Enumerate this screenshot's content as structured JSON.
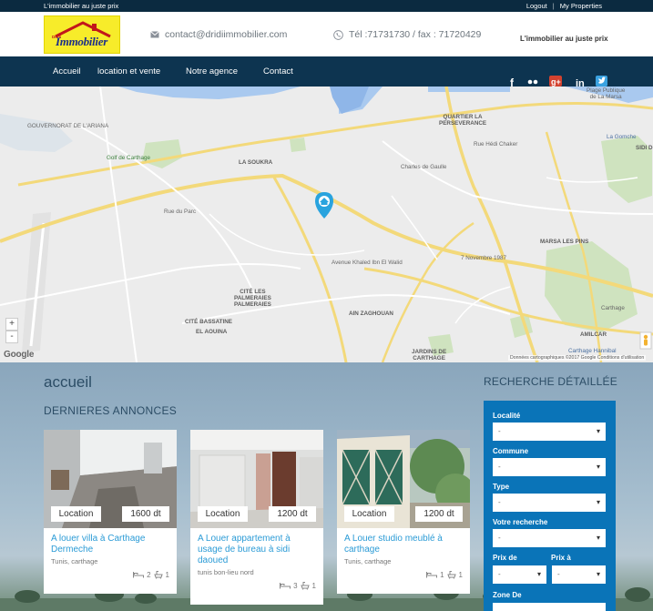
{
  "topbar": {
    "tagline": "L'immobilier au juste prix",
    "logout": "Logout",
    "separator": "|",
    "properties": "My Properties"
  },
  "header": {
    "logo_text": "Immobilier",
    "logo_mini": "Dridi",
    "email": "contact@dridiimmobilier.com",
    "phone": "Tél :71731730 / fax : 71720429",
    "slogan": "L'immobilier au juste prix"
  },
  "nav": {
    "items": [
      "Accueil",
      "location et vente",
      "Notre agence",
      "Contact"
    ],
    "social": [
      "facebook-icon",
      "flickr-icon",
      "google-plus-icon",
      "linkedin-icon",
      "twitter-icon"
    ]
  },
  "map": {
    "labels": {
      "quartier": "QUARTIER LA\nPERSEVERANCE",
      "plage": "Plage Publique\nde La Marsa",
      "golf": "Golf de Carthage",
      "soukra": "LA SOUKRA",
      "gomche": "La Gomche",
      "sidi": "SIDI D",
      "marsa": "MARSA LES PINS",
      "ariana": "GOUVERNORAT DE L'ARIANA",
      "cite_palmeraies": "CITÉ LES\nPALMERAIES\nPALMERAIES",
      "cite_bassatine": "CITÉ BASSATINE",
      "aouina": "EL AOUINA",
      "ain": "AIN ZAGHOUAN",
      "jardins": "JARDINS DE\nCARTHAGE",
      "amilcar": "AMILCAR",
      "carthage": "Carthage",
      "hannibal": "Carthage Hannibal",
      "nov": "7 Novembre 1987",
      "rue_paris": "Rue du Parc",
      "rue_hedi": "Rue Hédi Chaker",
      "charles": "Charles de Gaulle",
      "habib": "Avenue Khaled Ibn El Walid"
    },
    "zoom_in": "+",
    "zoom_out": "-",
    "google": "Google",
    "copyright": "Données cartographiques ©2017 Google   Conditions d'utilisation"
  },
  "main": {
    "page_title": "accueil",
    "section_title": "DERNIERES ANNONCES",
    "search_title": "RECHERCHE DÉTAILLÉE"
  },
  "listings": [
    {
      "type": "Location",
      "price": "1600 dt",
      "title": "A louer villa à Carthage Dermeche",
      "location": "Tunis, carthage",
      "rooms": "2",
      "baths": "1"
    },
    {
      "type": "Location",
      "price": "1200 dt",
      "title": "A Louer appartement à usage de bureau à sidi daoued",
      "location": "tunis bon-lieu nord",
      "rooms": "3",
      "baths": "1"
    },
    {
      "type": "Location",
      "price": "1200 dt",
      "title": "A Louer studio meublé à carthage",
      "location": "Tunis, carthage",
      "rooms": "1",
      "baths": "1"
    }
  ],
  "search": {
    "localite_label": "Localité",
    "commune_label": "Commune",
    "type_label": "Type",
    "recherche_label": "Votre recherche",
    "prix_de_label": "Prix de",
    "prix_a_label": "Prix à",
    "zone_label": "Zone De",
    "default_value": "-"
  }
}
